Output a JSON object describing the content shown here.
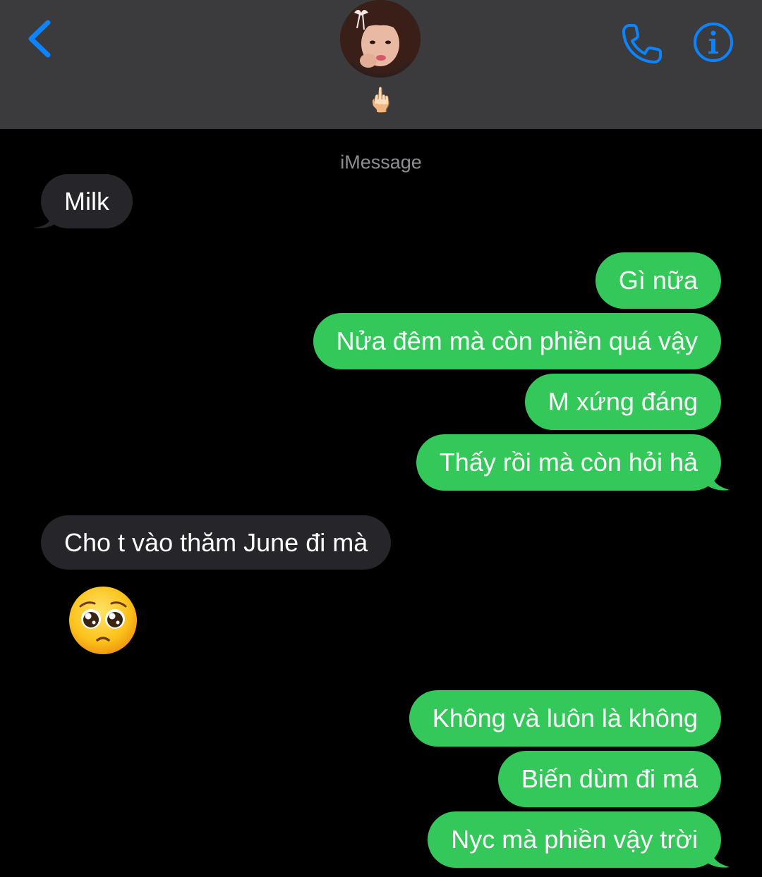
{
  "header": {
    "contact_name": "🖕🏻",
    "back_icon": "chevron-left-icon",
    "call_icon": "phone-icon",
    "info_icon": "info-icon",
    "accent_color": "#0a84ff"
  },
  "thread": {
    "service_label": "iMessage",
    "sent_color": "#34c759",
    "received_color": "#262529",
    "messages": [
      {
        "direction": "received",
        "text": "Milk"
      },
      {
        "direction": "sent",
        "text": "Gì nữa"
      },
      {
        "direction": "sent",
        "text": "Nửa đêm mà còn phiền quá vậy"
      },
      {
        "direction": "sent",
        "text": "M xứng đáng"
      },
      {
        "direction": "sent",
        "text": "Thấy rồi mà còn hỏi hả"
      },
      {
        "direction": "received",
        "text": "Cho t vào thăm June đi mà"
      },
      {
        "direction": "received",
        "text": "",
        "emoji": "pleading-face-icon"
      },
      {
        "direction": "sent",
        "text": "Không và luôn là không"
      },
      {
        "direction": "sent",
        "text": "Biến dùm đi má"
      },
      {
        "direction": "sent",
        "text": "Nyc mà phiền vậy trời"
      }
    ]
  }
}
